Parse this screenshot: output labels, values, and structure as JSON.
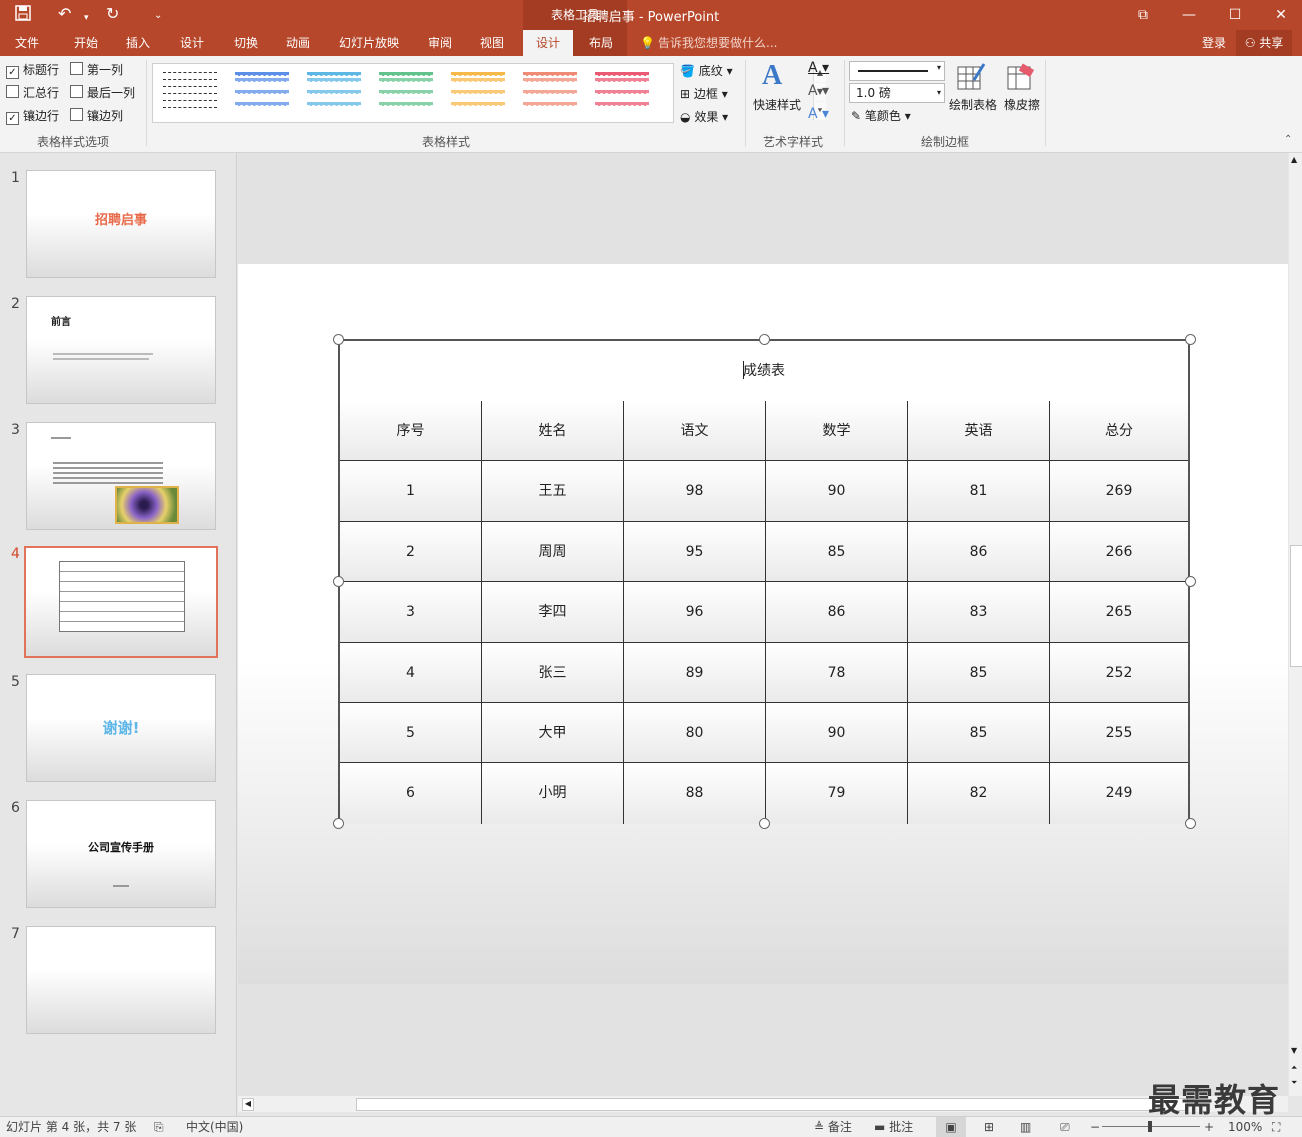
{
  "titlebar": {
    "title": "招聘启事 - PowerPoint",
    "contextual_label": "表格工具",
    "quick_access": [
      "save-icon",
      "undo-icon",
      "redo-icon",
      "customize-icon"
    ],
    "window_buttons": [
      "ribbon-display-icon",
      "minimize-icon",
      "maximize-icon",
      "close-icon"
    ]
  },
  "tabs": [
    {
      "label": "文件"
    },
    {
      "label": "开始"
    },
    {
      "label": "插入"
    },
    {
      "label": "设计"
    },
    {
      "label": "切换"
    },
    {
      "label": "动画"
    },
    {
      "label": "幻灯片放映"
    },
    {
      "label": "审阅"
    },
    {
      "label": "视图"
    },
    {
      "label": "设计"
    },
    {
      "label": "布局"
    }
  ],
  "tellme": "告诉我您想要做什么...",
  "account": {
    "login": "登录",
    "share": "共享"
  },
  "ribbon": {
    "options": {
      "header_row": "标题行",
      "first_col": "第一列",
      "total_row": "汇总行",
      "last_col": "最后一列",
      "banded_rows": "镶边行",
      "banded_cols": "镶边列",
      "group_label": "表格样式选项"
    },
    "styles_group_label": "表格样式",
    "shading": "底纹",
    "borders": "边框",
    "effects": "效果",
    "wordart": {
      "quick_styles": "快速样式",
      "group_label": "艺术字样式"
    },
    "draw": {
      "pen_weight": "1.0 磅",
      "pen_color": "笔颜色",
      "draw_table": "绘制表格",
      "eraser": "橡皮擦",
      "group_label": "绘制边框"
    },
    "style_colors": [
      "#ffffff",
      "#5b8fe8",
      "#5cb7e5",
      "#62c28b",
      "#f7b84a",
      "#ef8a74",
      "#ea5a72"
    ]
  },
  "thumbnails": [
    {
      "num": "1",
      "title": "招聘启事"
    },
    {
      "num": "2",
      "title": "前言"
    },
    {
      "num": "3",
      "title": ""
    },
    {
      "num": "4",
      "title": ""
    },
    {
      "num": "5",
      "title": "谢谢!"
    },
    {
      "num": "6",
      "title": "公司宣传手册"
    },
    {
      "num": "7",
      "title": ""
    }
  ],
  "table": {
    "title": "成绩表",
    "headers": [
      "序号",
      "姓名",
      "语文",
      "数学",
      "英语",
      "总分"
    ],
    "rows": [
      [
        "1",
        "王五",
        "98",
        "90",
        "81",
        "269"
      ],
      [
        "2",
        "周周",
        "95",
        "85",
        "86",
        "266"
      ],
      [
        "3",
        "李四",
        "96",
        "86",
        "83",
        "265"
      ],
      [
        "4",
        "张三",
        "89",
        "78",
        "85",
        "252"
      ],
      [
        "5",
        "大甲",
        "80",
        "90",
        "85",
        "255"
      ],
      [
        "6",
        "小明",
        "88",
        "79",
        "82",
        "249"
      ]
    ]
  },
  "statusbar": {
    "slide_info": "幻灯片 第 4 张，共 7 张",
    "language": "中文(中国)",
    "notes": "备注",
    "comments": "批注",
    "zoom": "100%"
  },
  "watermark": "最需教育"
}
